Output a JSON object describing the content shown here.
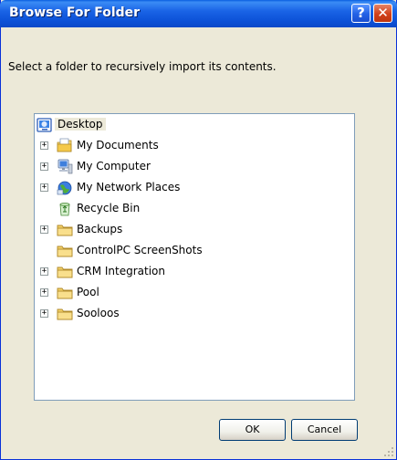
{
  "window": {
    "title": "Browse For Folder",
    "help_label": "?",
    "close_label": "✕"
  },
  "instructions": "Select a folder to recursively import its contents.",
  "tree": {
    "root": {
      "label": "Desktop",
      "icon": "desktop-icon",
      "selected": true
    },
    "items": [
      {
        "label": "My Documents",
        "icon": "my-documents-icon",
        "expander": "+"
      },
      {
        "label": "My Computer",
        "icon": "my-computer-icon",
        "expander": "+"
      },
      {
        "label": "My Network Places",
        "icon": "network-places-icon",
        "expander": "+"
      },
      {
        "label": "Recycle Bin",
        "icon": "recycle-bin-icon",
        "expander": ""
      },
      {
        "label": "Backups",
        "icon": "folder-icon",
        "expander": "+"
      },
      {
        "label": "ControlPC ScreenShots",
        "icon": "folder-icon",
        "expander": ""
      },
      {
        "label": "CRM Integration",
        "icon": "folder-icon",
        "expander": "+"
      },
      {
        "label": "Pool",
        "icon": "folder-icon",
        "expander": "+"
      },
      {
        "label": "Sooloos",
        "icon": "folder-icon",
        "expander": "+"
      }
    ]
  },
  "buttons": {
    "ok": "OK",
    "cancel": "Cancel"
  },
  "colors": {
    "title_bar": "#0a53d8",
    "dialog_bg": "#ece9d8",
    "selection_bg": "#ece9d8",
    "folder_yellow": "#f5d26a"
  }
}
